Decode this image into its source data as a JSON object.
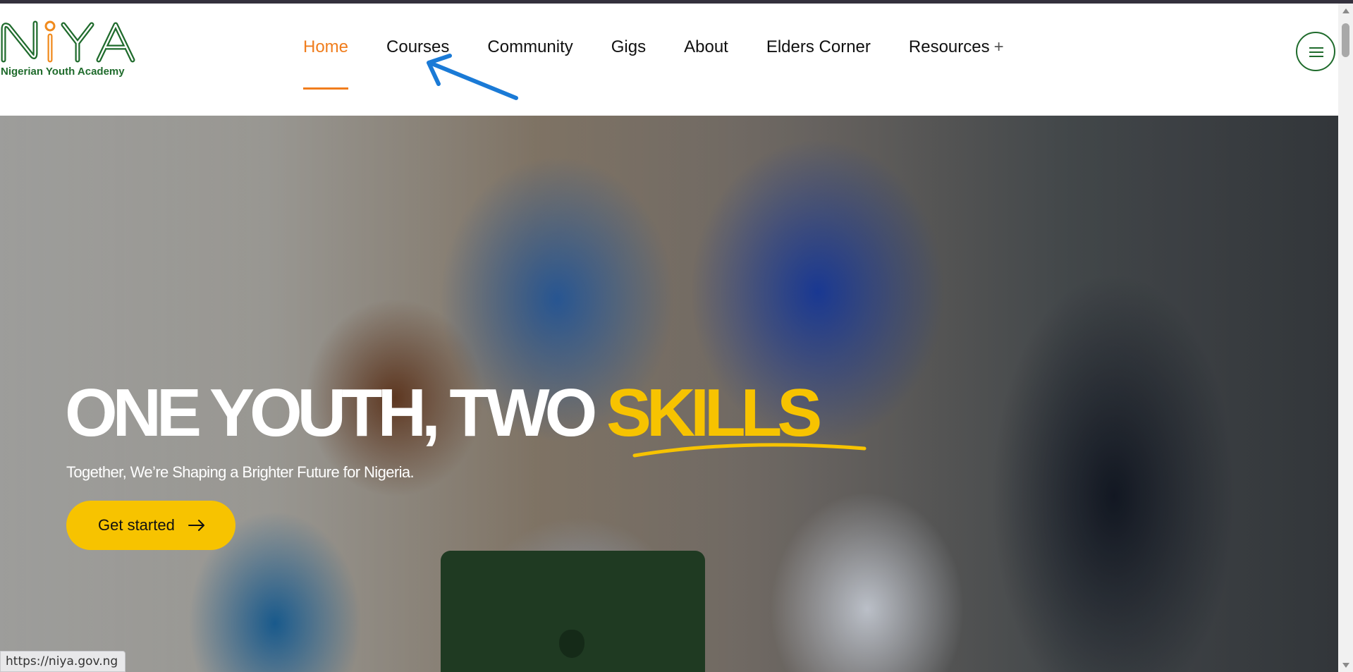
{
  "logo": {
    "name": "NiYA",
    "tagline": "Nigerian Youth Academy",
    "icon": "niya-logo"
  },
  "nav": {
    "items": [
      {
        "label": "Home",
        "active": true
      },
      {
        "label": "Courses",
        "active": false
      },
      {
        "label": "Community",
        "active": false
      },
      {
        "label": "Gigs",
        "active": false
      },
      {
        "label": "About",
        "active": false
      },
      {
        "label": "Elders Corner",
        "active": false
      },
      {
        "label": "Resources",
        "active": false
      }
    ],
    "resources_expand_icon": "+",
    "menu_icon": "hamburger-menu-icon"
  },
  "hero": {
    "title_main": "ONE YOUTH, TWO ",
    "title_accent": "SKILLS",
    "subtitle": "Together, We’re Shaping a Brighter Future for Nigeria.",
    "cta_label": "Get started",
    "cta_icon": "arrow-right-icon"
  },
  "status_bar": {
    "url": "https://niya.gov.ng"
  },
  "colors": {
    "brand_green": "#1f6b2c",
    "brand_orange": "#f07d1d",
    "accent_yellow": "#f7c300",
    "annotation_blue": "#1a7ad6"
  }
}
